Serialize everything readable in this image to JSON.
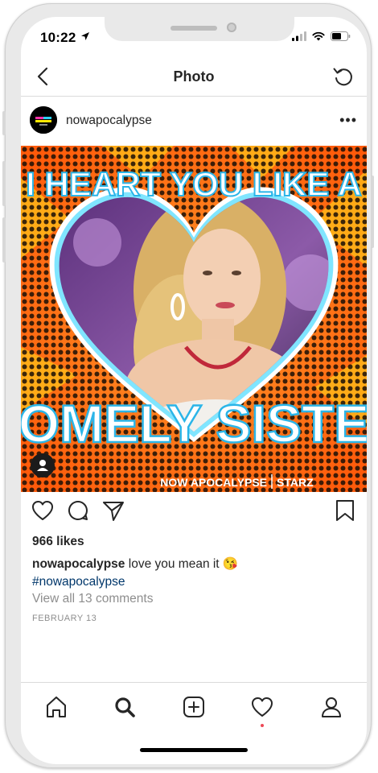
{
  "status_bar": {
    "time": "10:22"
  },
  "nav": {
    "title": "Photo"
  },
  "post": {
    "username": "nowapocalypse",
    "avatar_text": "NOW APOCALYPSE",
    "image": {
      "headline_top": "I HEART YOU LIKE A",
      "headline_bottom": "HOMELY SISTER",
      "brand_left": "NOW APOCALYPSE",
      "brand_right": "STARZ"
    },
    "likes": "966 likes",
    "caption_username": "nowapocalypse",
    "caption_text": "love you mean it 😘",
    "hashtag": "#nowapocalypse",
    "view_comments": "View all 13 comments",
    "date": "FEBRUARY 13"
  },
  "colors": {
    "accent_orange": "#ff6a12",
    "link_blue": "#00376b",
    "muted_gray": "#8e8e8e",
    "activity_dot": "#ed4956"
  },
  "tab_bar": {
    "items": [
      "home-icon",
      "search-icon",
      "new-post-icon",
      "activity-icon",
      "profile-icon"
    ]
  }
}
